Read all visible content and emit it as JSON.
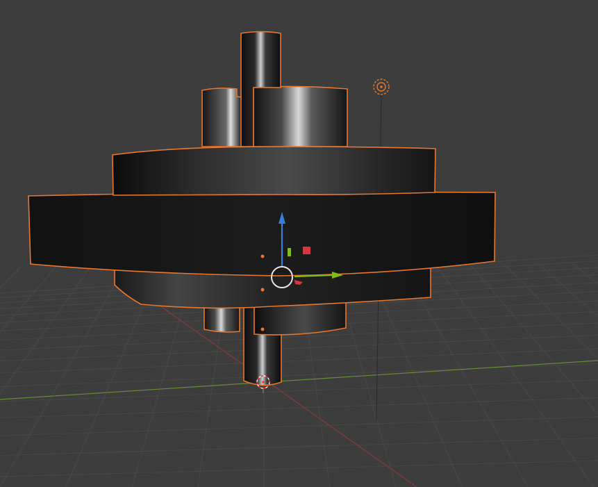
{
  "viewport": {
    "background": "#3d3d3d",
    "grid_color": "#474747",
    "x_axis_color": "#8a3838",
    "y_axis_color": "#6a8a3a",
    "selection_outline": "#e8772e"
  },
  "scene": {
    "objects": [
      {
        "name": "top-spindle",
        "kind": "cylinder",
        "selected": true
      },
      {
        "name": "left-post",
        "kind": "cylinder",
        "selected": true
      },
      {
        "name": "top-hub",
        "kind": "cylinder",
        "selected": true
      },
      {
        "name": "upper-disc",
        "kind": "cylinder",
        "selected": true
      },
      {
        "name": "main-disc",
        "kind": "cylinder",
        "selected": true
      },
      {
        "name": "lower-disc",
        "kind": "cylinder",
        "selected": true
      },
      {
        "name": "bottom-hub",
        "kind": "cylinder",
        "selected": true
      },
      {
        "name": "bottom-spindle",
        "kind": "cylinder",
        "selected": true
      }
    ],
    "light": {
      "name": "point-light",
      "icon": "light-icon"
    },
    "cursor": {
      "icon": "3d-cursor-icon"
    }
  },
  "gizmo": {
    "icons": [
      "move-gizmo-center-icon",
      "z-axis-arrow-icon",
      "y-axis-arrow-icon",
      "x-axis-handle-icon",
      "xz-plane-handle-icon",
      "yz-plane-handle-icon"
    ],
    "colors": {
      "x": "#d7353f",
      "y": "#7fbb1c",
      "z": "#3a7dd8",
      "center": "#e6e6e6"
    }
  }
}
